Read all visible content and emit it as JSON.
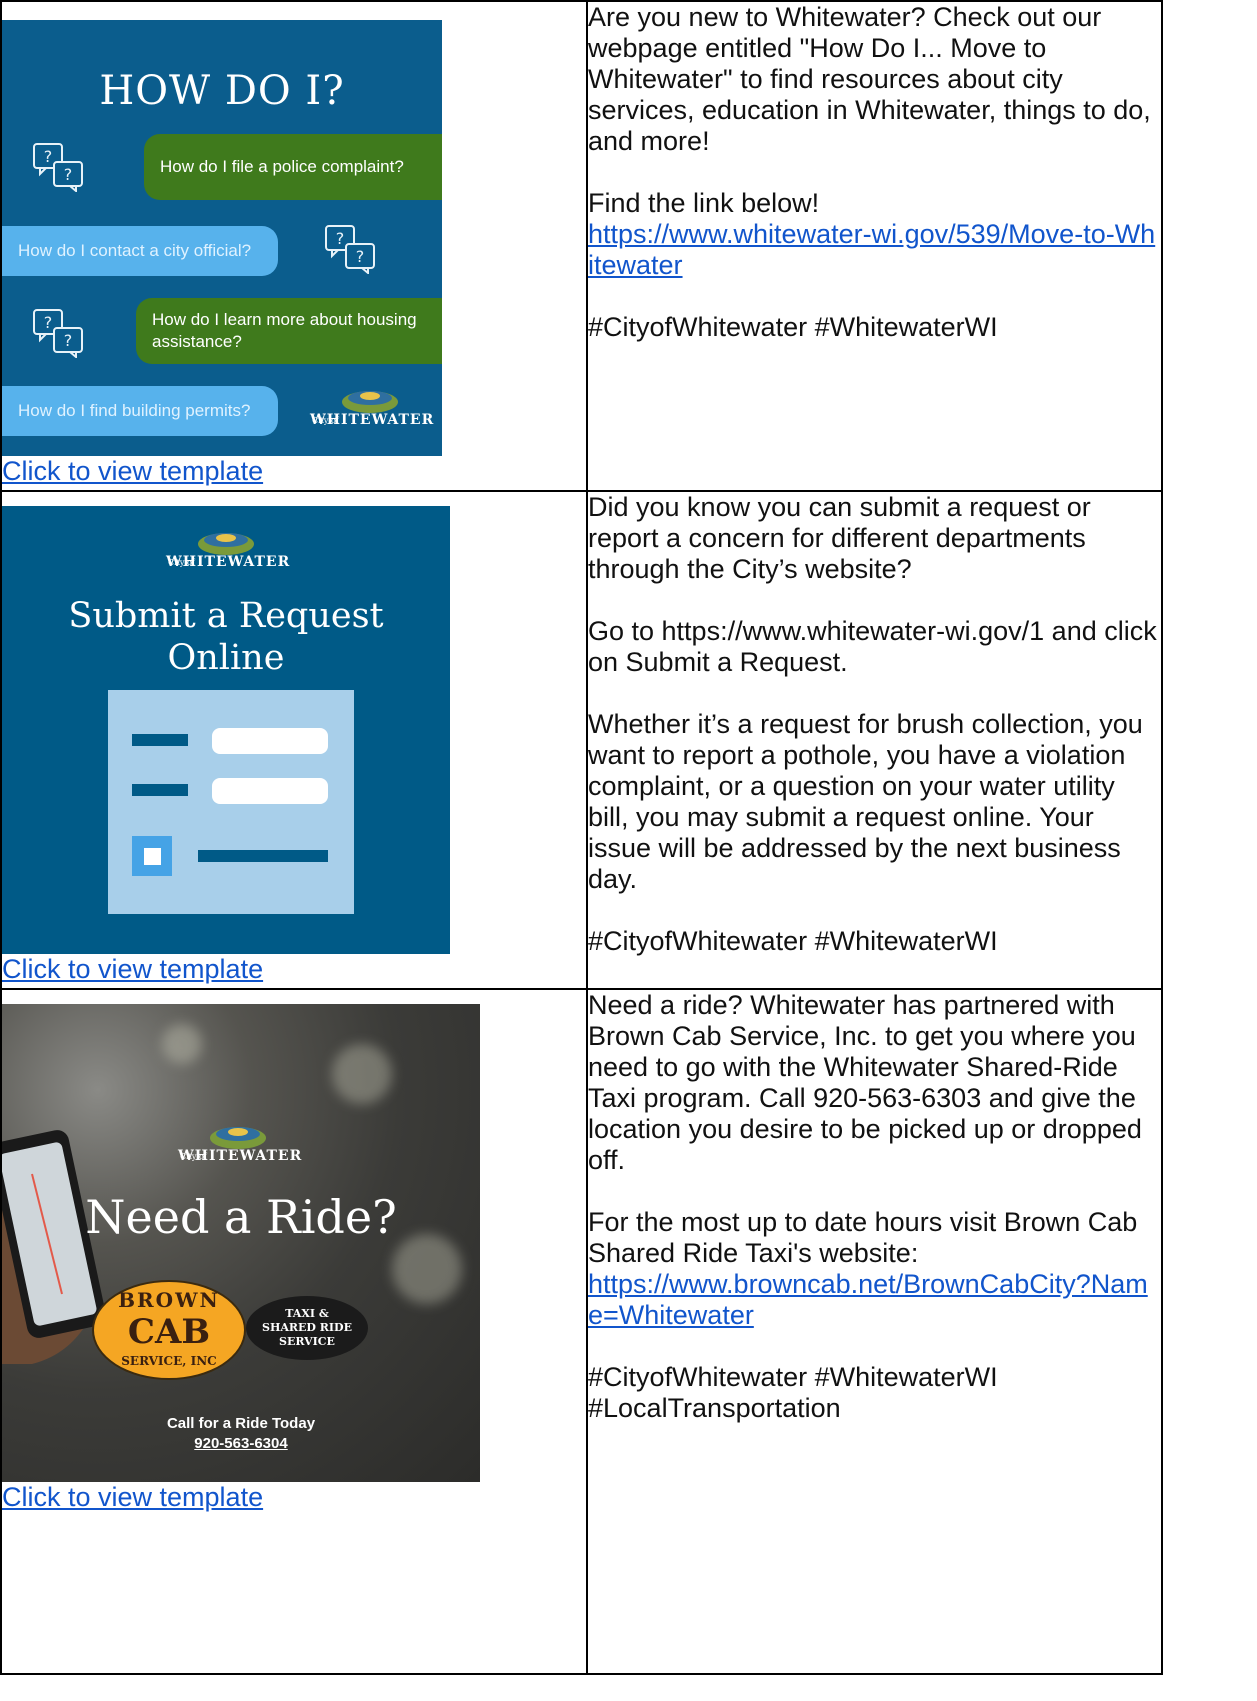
{
  "rows": [
    {
      "image": {
        "title": "HOW DO I?",
        "bubbles": [
          "How do I file a police complaint?",
          "How do I contact a city official?",
          "How do I learn more about housing assistance?",
          "How do I find building permits?"
        ],
        "logo_city": "City of",
        "logo_name": "WHITEWATER"
      },
      "template_link": "Click to view template",
      "paragraphs": [
        "Are you new to Whitewater? Check out our webpage entitled \"How Do I... Move to Whitewater\" to find resources about city services, education in Whitewater, things to do, and more!"
      ],
      "find_text": "Find the link below!",
      "url": "https://www.whitewater-wi.gov/539/Move-to-Whitewater",
      "hashtags": "#CityofWhitewater #WhitewaterWI"
    },
    {
      "image": {
        "logo_city": "City of",
        "logo_name": "WHITEWATER",
        "heading_line1": "Submit a Request",
        "heading_line2": "Online"
      },
      "template_link": "Click to view template",
      "paragraphs": [
        "Did you know you can submit a request or report a concern for different departments through the City’s website?",
        "Go to https://www.whitewater-wi.gov/1 and click on Submit a Request.",
        "Whether it’s a request for brush collection, you want to report a pothole, you have a violation complaint, or a question on your water utility bill, you may submit a request online.  Your issue will be addressed by the next business day."
      ],
      "hashtags": "#CityofWhitewater #WhitewaterWI"
    },
    {
      "image": {
        "logo_city": "City of",
        "logo_name": "WHITEWATER",
        "heading": "Need a Ride?",
        "oval_top": "BROWN",
        "oval_mid": "CAB",
        "oval_bottom": "SERVICE, INC",
        "badge_line1": "TAXI &",
        "badge_line2": "SHARED RIDE",
        "badge_line3": "SERVICE",
        "call_text": "Call for a Ride Today",
        "call_phone": "920-563-6304"
      },
      "template_link": "Click to view template",
      "paragraphs": [
        "Need a ride? Whitewater has partnered with Brown Cab Service, Inc. to get you where you need to go with the Whitewater Shared-Ride Taxi program. Call 920-563-6303 and give the location you desire to be picked up or dropped off."
      ],
      "hours_text": "For the most up to date hours visit Brown Cab Shared Ride Taxi's website:",
      "url": "https://www.browncab.net/BrownCabCity?Name=Whitewater",
      "hashtags": "#CityofWhitewater #WhitewaterWI",
      "hashtags2": "#LocalTransportation"
    }
  ],
  "colors": {
    "link": "#1155cc",
    "tile_blue": "#0b5d8d",
    "bubble_green": "#3f7a1c",
    "bubble_blue": "#57b2ec",
    "cab_yellow": "#f5a623"
  }
}
